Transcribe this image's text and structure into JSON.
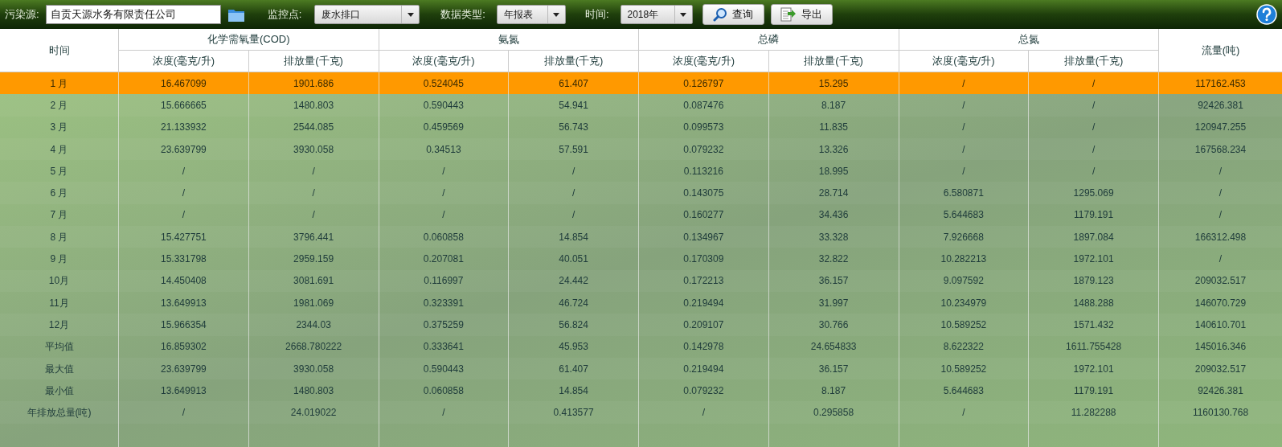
{
  "toolbar": {
    "source_label": "污染源:",
    "source_value": "自贡天源水务有限责任公司",
    "monitor_label": "监控点:",
    "monitor_value": "废水排口",
    "type_label": "数据类型:",
    "type_value": "年报表",
    "time_label": "时间:",
    "time_value": "2018年",
    "buttons": [
      {
        "label": "查询",
        "kind": "search"
      },
      {
        "label": "导出",
        "kind": "export"
      }
    ]
  },
  "table": {
    "time_header": "时间",
    "flow_header": "流量(吨)",
    "groups": [
      {
        "title": "化学需氧量(COD)",
        "columns": [
          "浓度(毫克/升)",
          "排放量(千克)"
        ]
      },
      {
        "title": "氨氮",
        "columns": [
          "浓度(毫克/升)",
          "排放量(千克)"
        ]
      },
      {
        "title": "总磷",
        "columns": [
          "浓度(毫克/升)",
          "排放量(千克)"
        ]
      },
      {
        "title": "总氮",
        "columns": [
          "浓度(毫克/升)",
          "排放量(千克)"
        ]
      }
    ],
    "rows": [
      {
        "time": "1 月",
        "cells": [
          "16.467099",
          "1901.686",
          "0.524045",
          "61.407",
          "0.126797",
          "15.295",
          "/",
          "/"
        ],
        "flow": "117162.453",
        "selected": true
      },
      {
        "time": "2 月",
        "cells": [
          "15.666665",
          "1480.803",
          "0.590443",
          "54.941",
          "0.087476",
          "8.187",
          "/",
          "/"
        ],
        "flow": "92426.381",
        "selected": false
      },
      {
        "time": "3 月",
        "cells": [
          "21.133932",
          "2544.085",
          "0.459569",
          "56.743",
          "0.099573",
          "11.835",
          "/",
          "/"
        ],
        "flow": "120947.255",
        "selected": false
      },
      {
        "time": "4 月",
        "cells": [
          "23.639799",
          "3930.058",
          "0.34513",
          "57.591",
          "0.079232",
          "13.326",
          "/",
          "/"
        ],
        "flow": "167568.234",
        "selected": false
      },
      {
        "time": "5 月",
        "cells": [
          "/",
          "/",
          "/",
          "/",
          "0.113216",
          "18.995",
          "/",
          "/"
        ],
        "flow": "/",
        "selected": false
      },
      {
        "time": "6 月",
        "cells": [
          "/",
          "/",
          "/",
          "/",
          "0.143075",
          "28.714",
          "6.580871",
          "1295.069"
        ],
        "flow": "/",
        "selected": false
      },
      {
        "time": "7 月",
        "cells": [
          "/",
          "/",
          "/",
          "/",
          "0.160277",
          "34.436",
          "5.644683",
          "1179.191"
        ],
        "flow": "/",
        "selected": false
      },
      {
        "time": "8 月",
        "cells": [
          "15.427751",
          "3796.441",
          "0.060858",
          "14.854",
          "0.134967",
          "33.328",
          "7.926668",
          "1897.084"
        ],
        "flow": "166312.498",
        "selected": false
      },
      {
        "time": "9 月",
        "cells": [
          "15.331798",
          "2959.159",
          "0.207081",
          "40.051",
          "0.170309",
          "32.822",
          "10.282213",
          "1972.101"
        ],
        "flow": "/",
        "selected": false
      },
      {
        "time": "10月",
        "cells": [
          "14.450408",
          "3081.691",
          "0.116997",
          "24.442",
          "0.172213",
          "36.157",
          "9.097592",
          "1879.123"
        ],
        "flow": "209032.517",
        "selected": false
      },
      {
        "time": "11月",
        "cells": [
          "13.649913",
          "1981.069",
          "0.323391",
          "46.724",
          "0.219494",
          "31.997",
          "10.234979",
          "1488.288"
        ],
        "flow": "146070.729",
        "selected": false
      },
      {
        "time": "12月",
        "cells": [
          "15.966354",
          "2344.03",
          "0.375259",
          "56.824",
          "0.209107",
          "30.766",
          "10.589252",
          "1571.432"
        ],
        "flow": "140610.701",
        "selected": false
      },
      {
        "time": "平均值",
        "cells": [
          "16.859302",
          "2668.780222",
          "0.333641",
          "45.953",
          "0.142978",
          "24.654833",
          "8.622322",
          "1611.755428"
        ],
        "flow": "145016.346",
        "selected": false
      },
      {
        "time": "最大值",
        "cells": [
          "23.639799",
          "3930.058",
          "0.590443",
          "61.407",
          "0.219494",
          "36.157",
          "10.589252",
          "1972.101"
        ],
        "flow": "209032.517",
        "selected": false
      },
      {
        "time": "最小值",
        "cells": [
          "13.649913",
          "1480.803",
          "0.060858",
          "14.854",
          "0.079232",
          "8.187",
          "5.644683",
          "1179.191"
        ],
        "flow": "92426.381",
        "selected": false
      },
      {
        "time": "年排放总量(吨)",
        "cells": [
          "/",
          "24.019022",
          "/",
          "0.413577",
          "/",
          "0.295858",
          "/",
          "11.282288"
        ],
        "flow": "1160130.768",
        "selected": false
      }
    ]
  }
}
